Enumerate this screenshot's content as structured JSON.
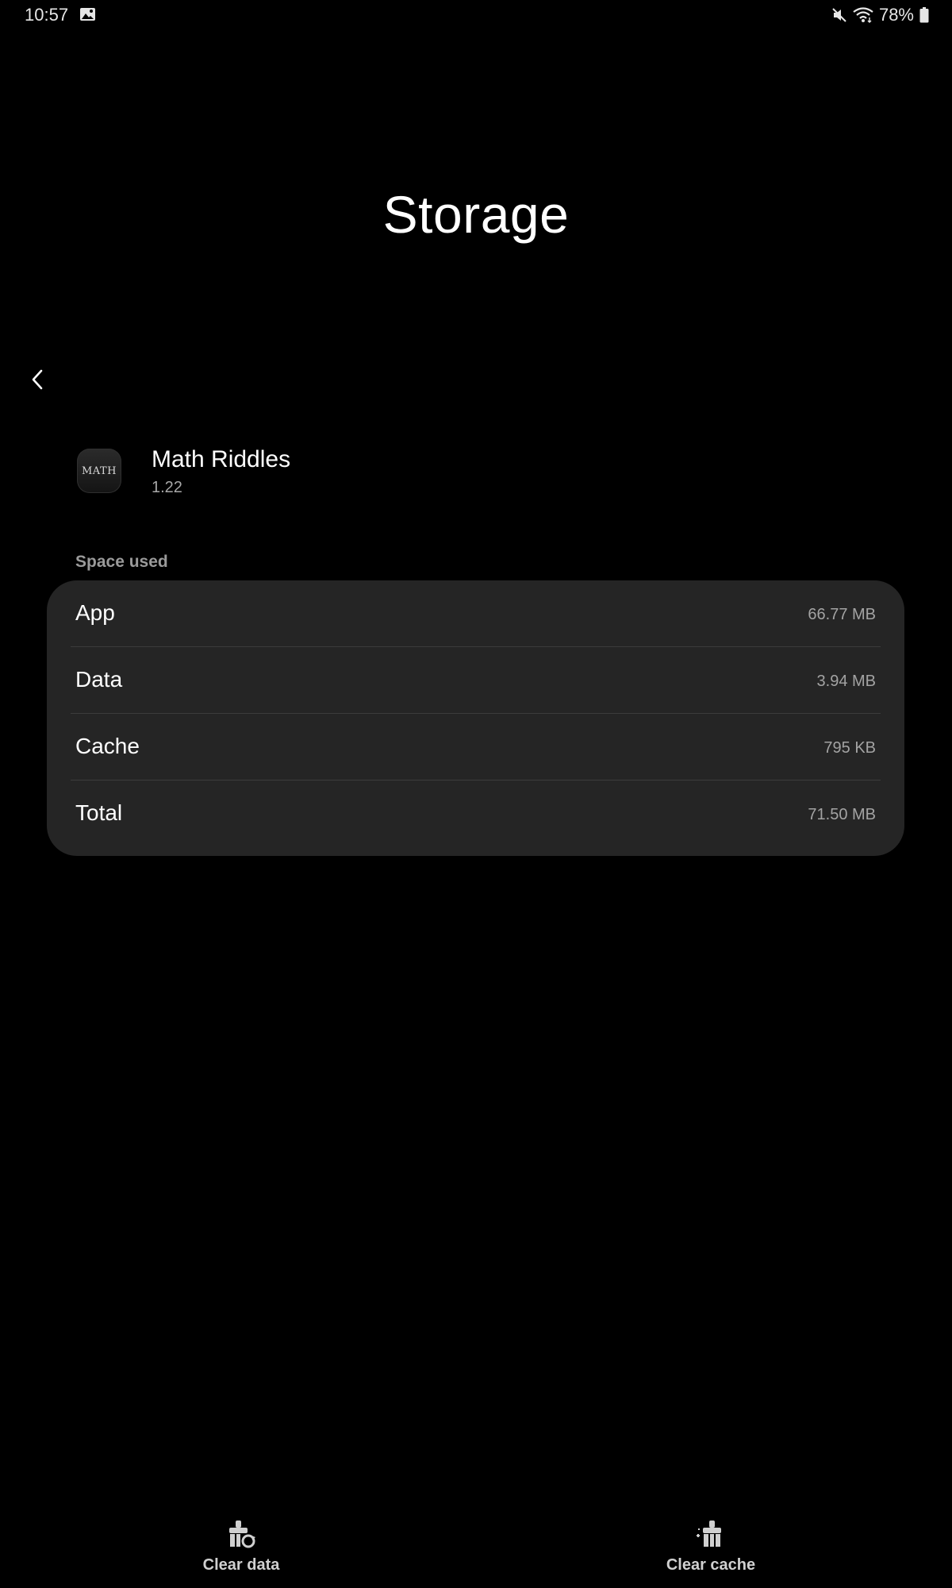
{
  "status_bar": {
    "time": "10:57",
    "battery_text": "78%",
    "icons": [
      "gallery-icon",
      "mute-icon",
      "wifi-icon",
      "battery-icon"
    ]
  },
  "page": {
    "title": "Storage",
    "back_icon": "chevron-left-icon"
  },
  "app": {
    "icon_text": "MATH",
    "name": "Math Riddles",
    "version": "1.22"
  },
  "space_used": {
    "header": "Space used",
    "rows": [
      {
        "label": "App",
        "value": "66.77 MB"
      },
      {
        "label": "Data",
        "value": "3.94 MB"
      },
      {
        "label": "Cache",
        "value": "795 KB"
      },
      {
        "label": "Total",
        "value": "71.50 MB"
      }
    ]
  },
  "actions": {
    "clear_data": {
      "label": "Clear data",
      "icon": "clear-data-icon"
    },
    "clear_cache": {
      "label": "Clear cache",
      "icon": "clear-cache-icon"
    }
  },
  "colors": {
    "background": "#000000",
    "card": "#252525",
    "text_primary": "#ffffff",
    "text_secondary": "#a3a3a3"
  }
}
